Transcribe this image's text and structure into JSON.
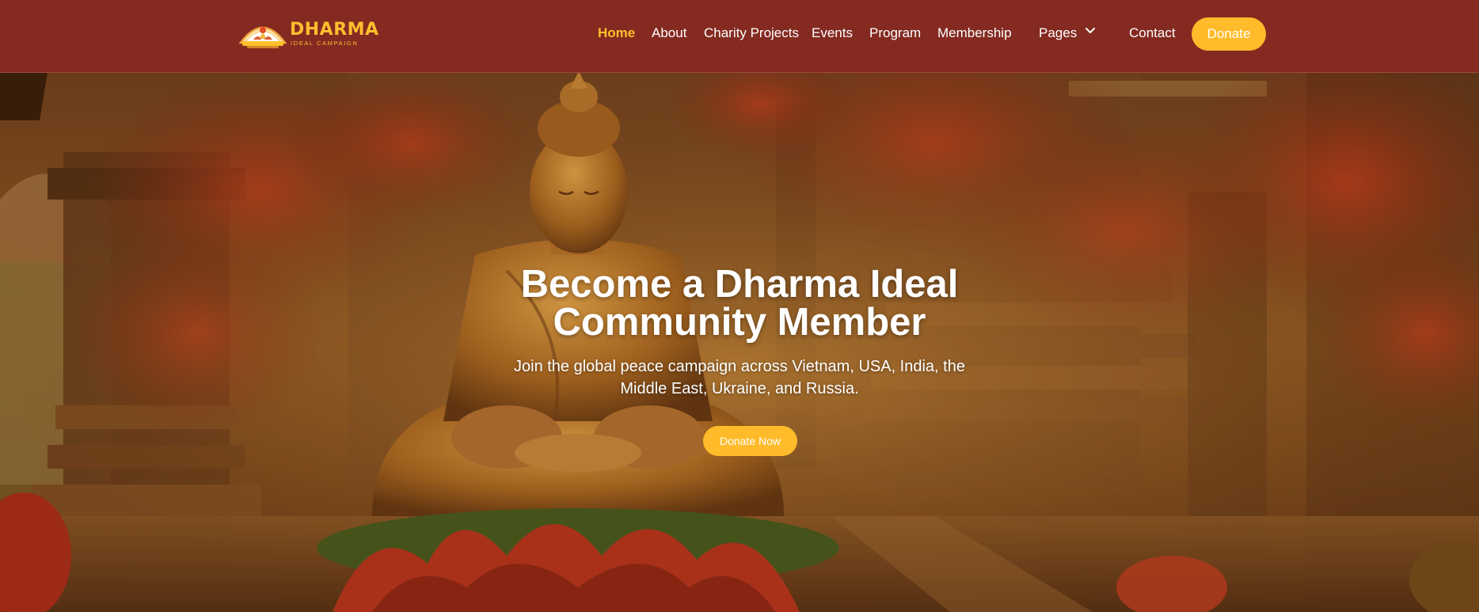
{
  "brand": {
    "name": "DHARMA",
    "tagline": "IDEAL CAMPAIGN",
    "logo_icon": "lotus-emblem-icon"
  },
  "nav": {
    "items": [
      {
        "label": "Home",
        "active": true
      },
      {
        "label": "About"
      },
      {
        "label": "Charity Projects"
      },
      {
        "label": "Events"
      },
      {
        "label": "Program"
      },
      {
        "label": "Membership"
      },
      {
        "label": "Pages",
        "icon": "chevron-down-icon"
      },
      {
        "label": "Contact"
      }
    ],
    "cta_label": "Donate"
  },
  "hero": {
    "title_line1": "Become a Dharma Ideal",
    "title_line2": "Community Member",
    "subtitle_line1": "Join the global peace campaign across Vietnam, USA, India, the",
    "subtitle_line2": "Middle East, Ukraine, and Russia.",
    "cta_label": "Donate Now",
    "background": "meditating-buddha-statue-temple-image"
  },
  "colors": {
    "header_bg": "#842a21",
    "accent": "#ffbb2a",
    "active_link": "#ffbf2e",
    "text": "#ffffff"
  }
}
